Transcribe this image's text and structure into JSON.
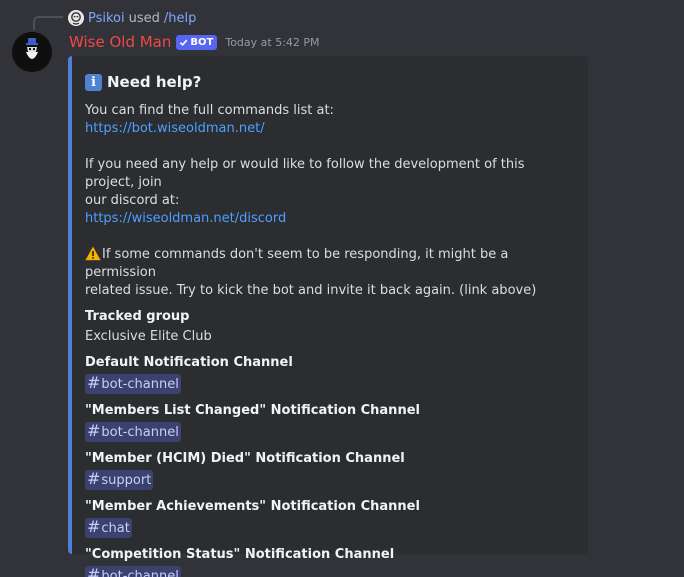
{
  "reply": {
    "username": "Psikoi",
    "used_text": "used",
    "command": "/help"
  },
  "message": {
    "author": "Wise Old Man",
    "bot_tag": "BOT",
    "timestamp": "Today at 5:42 PM"
  },
  "colors": {
    "author": "#f04848",
    "embed_border": "#4f7fd6",
    "link": "#4ca0ff",
    "bot_tag": "#5865f2"
  },
  "embed": {
    "title_icon": "information-icon",
    "title": "Need help?",
    "desc_line1": "You can find the full commands list at:",
    "link1": "https://bot.wiseoldman.net/",
    "desc_line2a": "If you need any help or would like to follow the development of this project, join",
    "desc_line2b": "our discord at:",
    "link2": "https://wiseoldman.net/discord",
    "warning_icon": "warning-icon",
    "desc_line3a": "If some commands don't seem to be responding, it might be a permission",
    "desc_line3b": "related issue. Try to kick the bot and invite it back again. (link above)",
    "fields": [
      {
        "name": "Tracked group",
        "value": "Exclusive Elite Club"
      },
      {
        "name": "Default Notification Channel",
        "channel": "bot-channel"
      },
      {
        "name": "\"Members List Changed\" Notification Channel",
        "channel": "bot-channel"
      },
      {
        "name": "\"Member (HCIM) Died\" Notification Channel",
        "channel": "support"
      },
      {
        "name": "\"Member Achievements\" Notification Channel",
        "channel": "chat"
      },
      {
        "name": "\"Competition Status\" Notification Channel",
        "channel": "bot-channel"
      }
    ]
  }
}
